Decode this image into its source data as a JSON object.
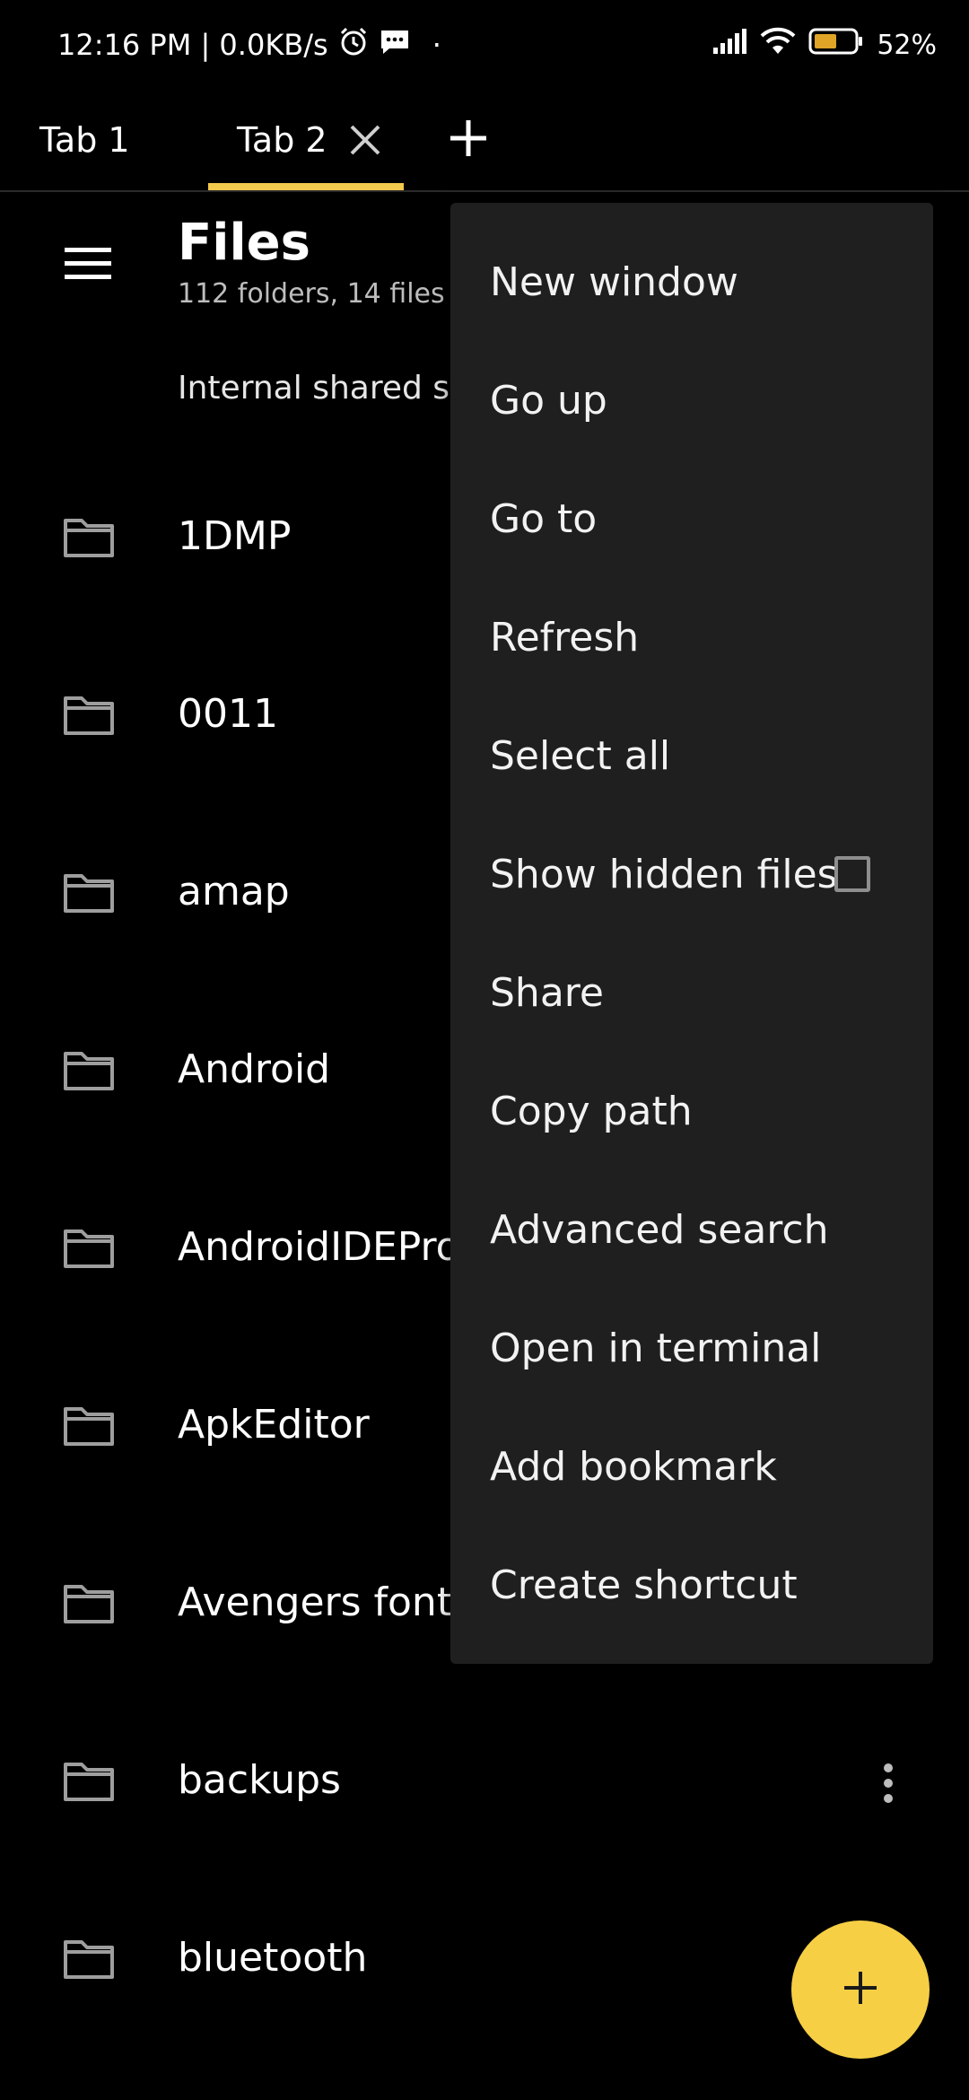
{
  "statusbar": {
    "time_speed": "12:16 PM | 0.0KB/s",
    "dot": "·",
    "battery_percent": "52%"
  },
  "tabs": [
    {
      "label": "Tab 1"
    },
    {
      "label": "Tab 2"
    }
  ],
  "header": {
    "title": "Files",
    "subtitle": "112 folders, 14 files"
  },
  "breadcrumb": "Internal shared storage",
  "files": [
    {
      "name": "1DMP"
    },
    {
      "name": "0011"
    },
    {
      "name": "amap"
    },
    {
      "name": "Android"
    },
    {
      "name": "AndroidIDEProjects"
    },
    {
      "name": "ApkEditor"
    },
    {
      "name": "Avengers font"
    },
    {
      "name": "backups"
    },
    {
      "name": "bluetooth"
    }
  ],
  "menu": {
    "items": [
      {
        "label": "New window"
      },
      {
        "label": "Go up"
      },
      {
        "label": "Go to"
      },
      {
        "label": "Refresh"
      },
      {
        "label": "Select all"
      },
      {
        "label": "Show hidden files"
      },
      {
        "label": "Share"
      },
      {
        "label": "Copy path"
      },
      {
        "label": "Advanced search"
      },
      {
        "label": "Open in terminal"
      },
      {
        "label": "Add bookmark"
      },
      {
        "label": "Create shortcut"
      }
    ],
    "show_hidden_files_checked": false
  },
  "colors": {
    "accent": "#f2c94c",
    "fab": "#f6cf45",
    "menu_bg": "#1f1f1f",
    "background": "#000000"
  },
  "icons": {
    "alarm": "alarm-icon",
    "message": "message-icon",
    "signal": "signal-icon",
    "wifi": "wifi-icon",
    "battery": "battery-icon",
    "close": "close-icon",
    "add": "add-icon",
    "menu": "hamburger-icon",
    "folder": "folder-icon",
    "more": "more-vert-icon"
  }
}
